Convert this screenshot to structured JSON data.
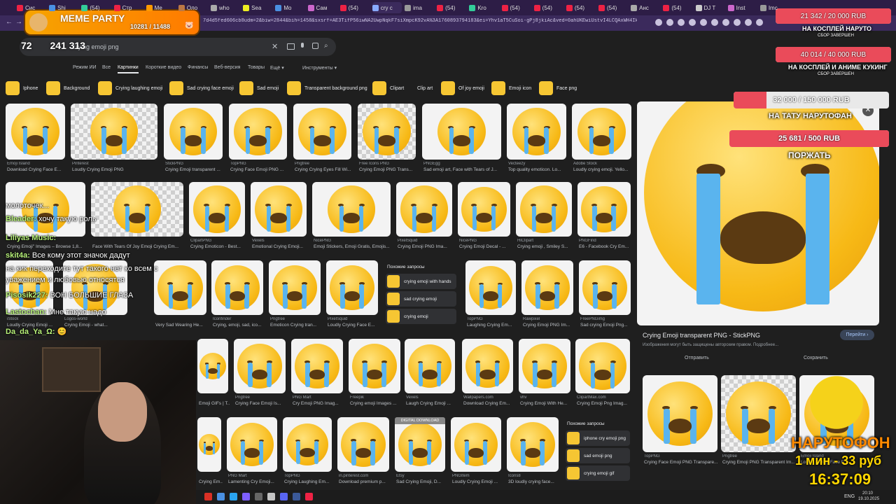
{
  "browser": {
    "tabs": [
      "Сис",
      "Shi",
      "(54)",
      "Стр",
      "Me",
      "Оло",
      "who",
      "Sea",
      "Mo",
      "Сам",
      "(54)",
      "cry c",
      "ima",
      "(54)",
      "Kro",
      "(54)",
      "(54)",
      "(54)",
      "(54)",
      "Анс",
      "(54)",
      "DJ T",
      "Inst",
      "Imc"
    ],
    "url": "7d4d5fed606cb8udm=2&biw=2844&bih=1458&sxsrf=AE3TifP56iwNA2UwpNqkF7siXmpcK92vA%3A1760893794183&ei=Yhv1aT5CuSoi-gPj8jkiAc&ved=0ahUKEwiUstvI4LCQAxWH4IkEHQ8kGKE..."
  },
  "google": {
    "query": "crying emoji png",
    "nav_tabs": [
      "Режим ИИ",
      "Все",
      "Картинки",
      "Короткие видео",
      "Финансы",
      "Веб-версия",
      "Товары",
      "Ещё ▾",
      "Инструменты ▾"
    ],
    "chips": [
      "Iphone",
      "Background",
      "Crying laughing emoji",
      "Sad crying face emoji",
      "Sad emoji",
      "Transparent background png",
      "Clipart",
      "Clip art",
      "Of joy emoji",
      "Emoji icon",
      "Face png"
    ]
  },
  "grid": {
    "row1": [
      {
        "src": "Emoji Island",
        "cap": "Download Crying Face E..."
      },
      {
        "src": "Pinterest",
        "cap": "Loudly Crying Emoji PNG"
      },
      {
        "src": "StickPNG",
        "cap": "Crying Emoji transparent ..."
      },
      {
        "src": "TopPNG",
        "cap": "Crying Face Emoji PNG ..."
      },
      {
        "src": "Pngtree",
        "cap": "Crying Crying Eyes Fill Wi..."
      },
      {
        "src": "Free Icons PNG",
        "cap": "Crying Emoji PNG Trans..."
      },
      {
        "src": "PNGEgg",
        "cap": "Sad emoji art, Face with Tears of J..."
      },
      {
        "src": "Vecteezy",
        "cap": "Top quality emoticon. Lo..."
      },
      {
        "src": "Adobe Stock",
        "cap": "Loudly crying emoji. Yello..."
      }
    ],
    "row2": [
      {
        "src": "",
        "cap": "Crying Emoji\" Images – Browse 1,8..."
      },
      {
        "src": "",
        "cap": "Face With Tears Of Joy Emoji Crying Em..."
      },
      {
        "src": "ClipartPNG",
        "cap": "Crying Emoticon - Best..."
      },
      {
        "src": "Vexels",
        "cap": "Emotional Crying Emoji..."
      },
      {
        "src": "NicePNG",
        "cap": "Emoji Stickers, Emoji Gratis, Emojis..."
      },
      {
        "src": "PixelSquid",
        "cap": "Crying Emoji PNG Ima..."
      },
      {
        "src": "NicePNG",
        "cap": "Crying Emoji Decal - ..."
      },
      {
        "src": "HiClipart",
        "cap": "Crying emoji , Smiley S..."
      },
      {
        "src": "PNGFind",
        "cap": "E6 - Facebook Cry Em..."
      }
    ],
    "row3": [
      {
        "src": "iStock",
        "cap": "Loudly Crying Emoji ..."
      },
      {
        "src": "Logos-world",
        "cap": "Crying Emoji - what..."
      },
      {
        "src": "",
        "cap": "Very Sad Wearing He..."
      },
      {
        "src": "Iconfinder",
        "cap": "Crying, emoji, sad, ico..."
      },
      {
        "src": "Pngtree",
        "cap": "Emoticon Crying tran..."
      },
      {
        "src": "PixelSquid",
        "cap": "Loudly Crying Face E..."
      },
      {
        "src": "TopPNG",
        "cap": "Laughing Crying Em..."
      },
      {
        "src": "Rawpixel",
        "cap": "Crying Emoji PNG Im..."
      },
      {
        "src": "FreePNGimg",
        "cap": "Sad crying Emoji Png..."
      }
    ],
    "row4": [
      {
        "src": "",
        "cap": "Emoji GIFs | T..."
      },
      {
        "src": "Pngtree",
        "cap": "Crying Face Emoji Is..."
      },
      {
        "src": "PNG Mart",
        "cap": "Cry Emoji PNG Imag..."
      },
      {
        "src": "Freepik",
        "cap": "Crying emoji Images ..."
      },
      {
        "src": "Vexels",
        "cap": "Laugh Crying Emoji ..."
      },
      {
        "src": "Wallpapers.com",
        "cap": "Download Crying Em..."
      },
      {
        "src": "vhv",
        "cap": "Crying Emoji With He..."
      },
      {
        "src": "ClipartMax.com",
        "cap": "Crying Emoji Png Imag..."
      }
    ],
    "row5": [
      {
        "src": "",
        "cap": "Crying Em..."
      },
      {
        "src": "PNG Mart",
        "cap": "Lamenting Cry Emoji..."
      },
      {
        "src": "TopPNG",
        "cap": "Crying Laughing Em..."
      },
      {
        "src": "in.pinterest.com",
        "cap": "Download premium p..."
      },
      {
        "src": "Etsy",
        "cap": "Sad Crying Emoji, D..."
      },
      {
        "src": "PNGItem",
        "cap": "Loudly Crying Emoji ..."
      },
      {
        "src": "Icons8",
        "cap": "3D loudly crying face..."
      }
    ],
    "digital_badge": "DIGITAL DOWNLOAD"
  },
  "related1": {
    "title": "Похожие запросы",
    "items": [
      "crying emoji with hands",
      "sad crying emoji",
      "crying emoji"
    ]
  },
  "related2": {
    "title": "Похожие запросы",
    "items": [
      "iphone cry emoji png",
      "sad emoji png",
      "crying emoji gif"
    ]
  },
  "preview": {
    "title": "Crying Emoji transparent PNG - StickPNG",
    "note": "Изображения могут быть защищены авторским правом. Подробнее...",
    "go_label": "Перейти ›",
    "share_label": "Отправить",
    "save_label": "Сохранить",
    "thumbs": [
      {
        "src": "TopPNG",
        "cap": "Crying Face Emoji PNG Transpare..."
      },
      {
        "src": "Pngtree",
        "cap": "Crying Emoji PNG Transparent Im..."
      },
      {
        "src": "Emoji Island",
        "cap": "Loudly Crying Face E..."
      }
    ]
  },
  "overlay": {
    "logo_title": "MEME PARTY",
    "logo_count": "10281 / 11488",
    "counter_a": "72",
    "counter_b": "241",
    "counter_c": "313",
    "donations": [
      {
        "amount": "21 342 / 20 000 RUB",
        "label": "НА КОСПЛЕЙ НАРУТО",
        "sub": "СБОР ЗАВЕРШЕН",
        "progress": 1.0
      },
      {
        "amount": "40 014 / 40 000 RUB",
        "label": "НА КОСПЛЕЙ И АНИМЕ КУКИНГ",
        "sub": "СБОР ЗАВЕРШЕН",
        "progress": 1.0
      },
      {
        "amount": "32 000 / 150 000 RUB",
        "label": "НА ТАТУ НАРУТОФАН",
        "sub": "",
        "progress": 0.213
      },
      {
        "amount": "25 681 / 500 RUB",
        "label": "ПОРЖАТЬ",
        "sub": "",
        "progress": 1.0
      }
    ],
    "naruto_title": "НАРУТОФОН",
    "naruto_rate": "1 мин - 33 руб",
    "naruto_time": "16:37:09"
  },
  "chat": [
    {
      "user": "",
      "text": "молоточек..."
    },
    {
      "user": "Bleader:",
      "text": "хочу такую роль"
    },
    {
      "user": "Liliyas Music:",
      "text": ""
    },
    {
      "user": "skit4a:",
      "text": "Все кому этот значок дадут"
    },
    {
      "user": "",
      "text": "на кик переходите тут такого нет ко всем с"
    },
    {
      "user": "",
      "text": "уважением и любовью относятся"
    },
    {
      "user": "Pisosik227:",
      "text": "ВОН БОЛЬШИЕ ГЛАЗА"
    },
    {
      "user": "Lastochan:",
      "text": "Мне такую надо"
    },
    {
      "user": "Da_da_Ya_Ω:",
      "text": "😊"
    }
  ],
  "taskbar": {
    "lang": "ENG",
    "time": "20:10",
    "date": "19.10.2025"
  },
  "colors": {
    "tabbar": "#2d1d46",
    "addrbar": "#3b2a5c",
    "donation_fill": "#ea4b5a",
    "chat_user": "#b8f27a"
  }
}
